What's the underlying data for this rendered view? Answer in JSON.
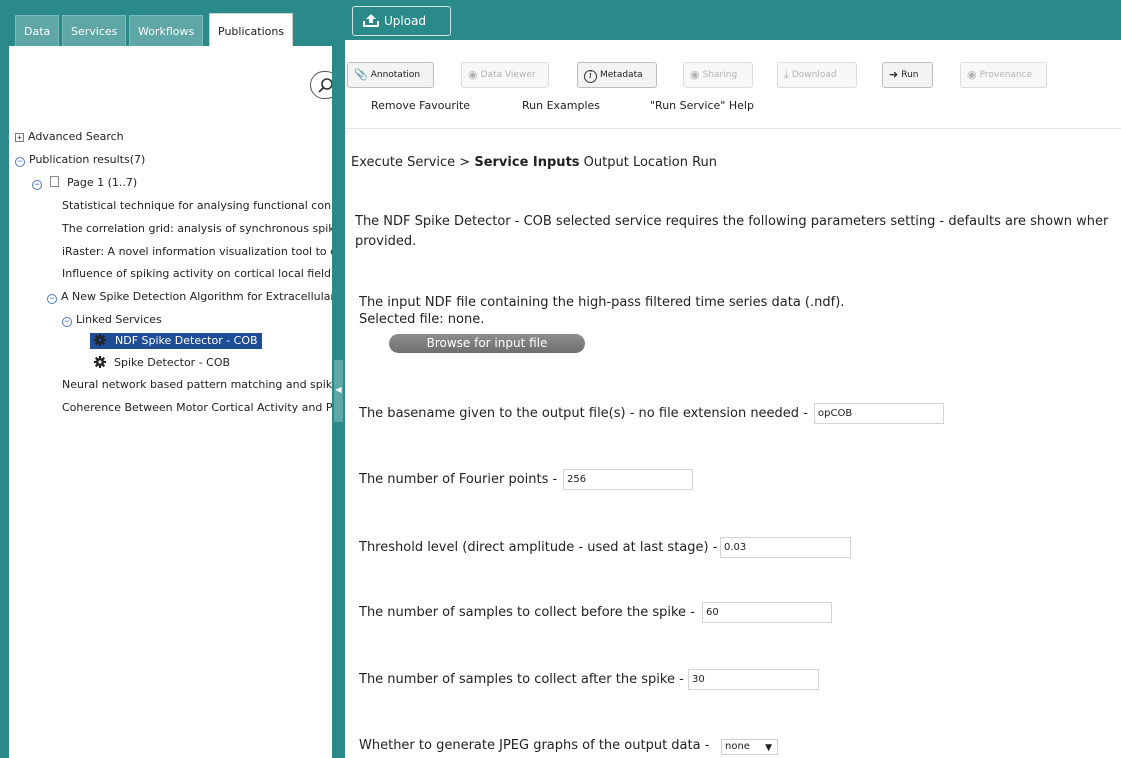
{
  "tabs": [
    {
      "label": "Data"
    },
    {
      "label": "Services"
    },
    {
      "label": "Workflows"
    },
    {
      "label": "Publications"
    }
  ],
  "tree": {
    "advanced_search": "Advanced Search",
    "results_label": "Publication results(7)",
    "page_label": "Page 1 (1..7)",
    "publications": [
      "Statistical technique for analysing functional conn",
      "The correlation grid: analysis of synchronous spiki",
      "iRaster: A novel information visualization tool to e",
      "Influence of spiking activity on cortical local field p",
      "A New Spike Detection Algorithm for Extracellular",
      "Neural network based pattern matching and spike",
      "Coherence Between Motor Cortical Activity and Pe"
    ],
    "linked_services_label": "Linked Services",
    "services": [
      "NDF Spike Detector - COB",
      "Spike Detector - COB"
    ],
    "expand_glyph": "+",
    "collapse_glyph": "−"
  },
  "toolbar": {
    "upload": "Upload",
    "annotation": "Annotation",
    "data_viewer": "Data Viewer",
    "metadata": "Metadata",
    "sharing": "Sharing",
    "download": "Download",
    "run": "Run",
    "provenance": "Provenance"
  },
  "links": {
    "remove_favourite": "Remove Favourite",
    "run_examples": "Run Examples",
    "run_service_help": "\"Run Service\" Help"
  },
  "breadcrumb": {
    "step1": "Execute Service >",
    "step2": "Service Inputs",
    "step3": "Output Location Run"
  },
  "intro": {
    "line1": "The NDF Spike Detector - COB selected service requires the following parameters setting - defaults are shown wher",
    "line2": "provided."
  },
  "input_file": {
    "description": "The input NDF file containing the high-pass filtered time series data (.ndf).",
    "selected": "Selected file: none.",
    "browse": "Browse for input file"
  },
  "params": [
    {
      "label": "The basename given to the output file(s) - no file extension needed -",
      "value": "opCOB"
    },
    {
      "label": "The number of Fourier points -",
      "value": "256"
    },
    {
      "label": "Threshold level (direct amplitude - used at last stage) -",
      "value": "0.03"
    },
    {
      "label": "The number of samples to collect before the spike -",
      "value": "60"
    },
    {
      "label": "The number of samples to collect after the spike -",
      "value": "30"
    }
  ],
  "jpeg": {
    "label": "Whether to generate JPEG graphs of the output data -",
    "selected": "none"
  },
  "colors": {
    "teal": "#2a8a8a",
    "selection": "#1f4d96"
  }
}
